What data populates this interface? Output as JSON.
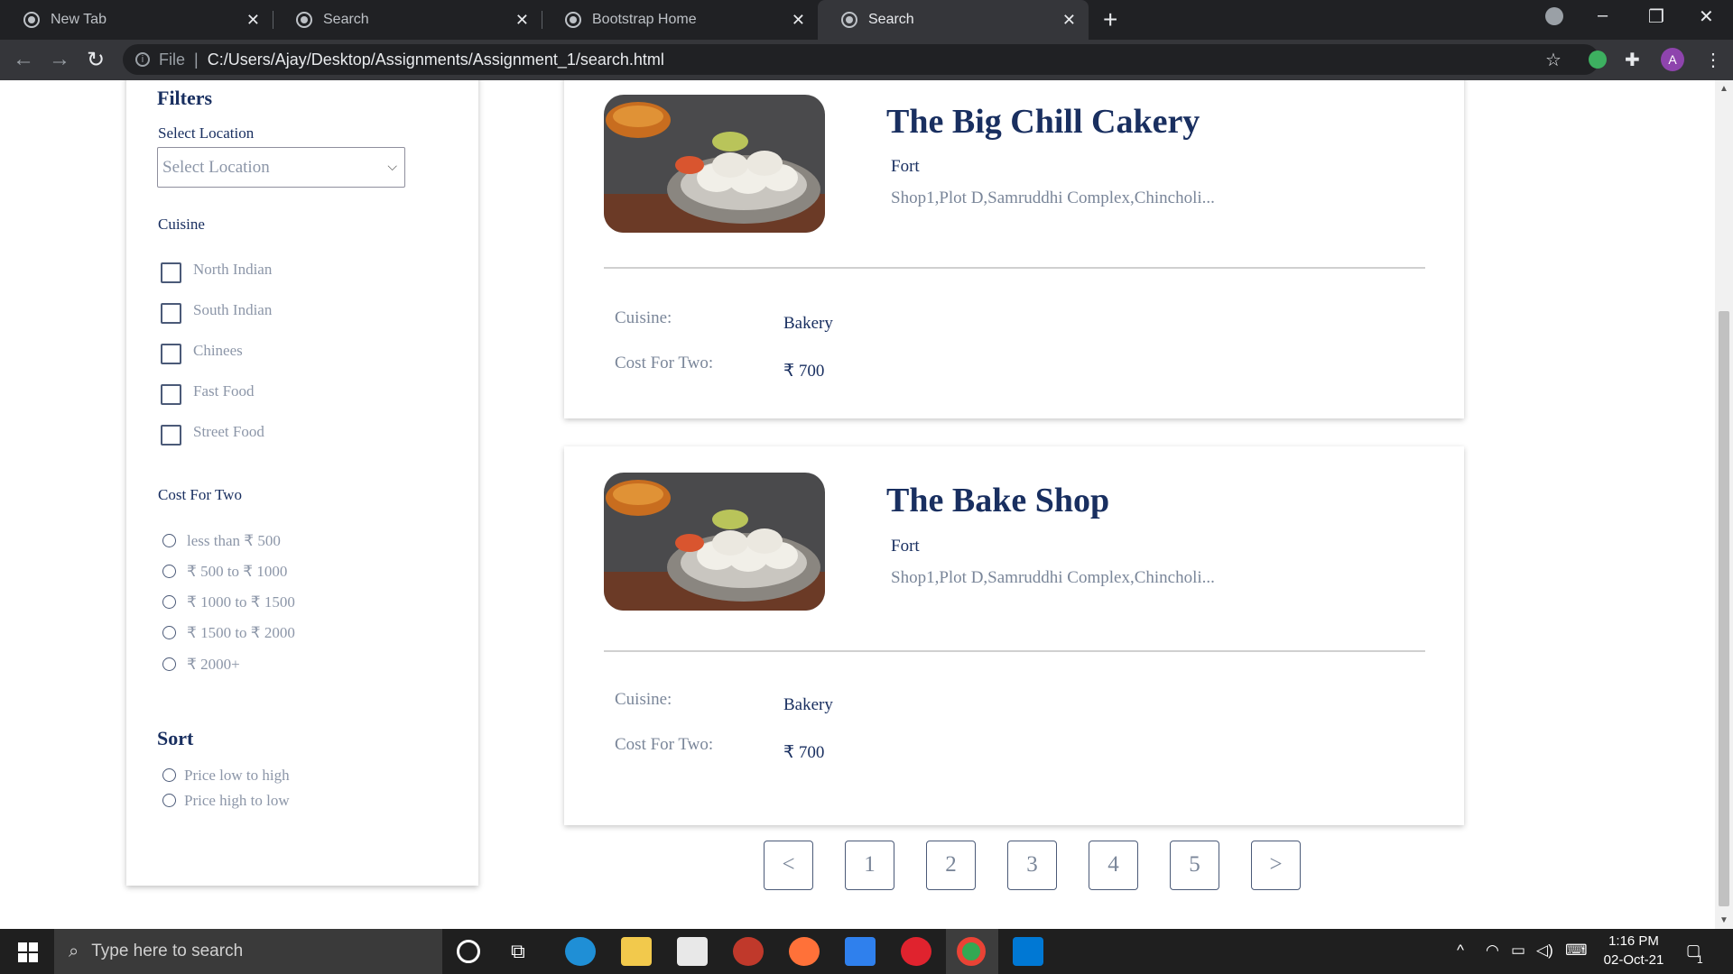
{
  "browser": {
    "tabs": [
      {
        "title": "New Tab"
      },
      {
        "title": "Search"
      },
      {
        "title": "Bootstrap Home"
      },
      {
        "title": "Search"
      }
    ],
    "new_tab": "+",
    "url_scheme": "File",
    "url": "C:/Users/Ajay/Desktop/Assignments/Assignment_1/search.html",
    "profile_initial": "A"
  },
  "filters": {
    "title": "Filters",
    "location_label": "Select Location",
    "location_placeholder": "Select Location",
    "cuisine_label": "Cuisine",
    "cuisines": [
      "North Indian",
      "South Indian",
      "Chinees",
      "Fast Food",
      "Street Food"
    ],
    "cost_label": "Cost For Two",
    "cost_ranges": [
      "less than ₹ 500",
      "₹ 500 to ₹ 1000",
      "₹ 1000 to ₹ 1500",
      "₹ 1500 to ₹ 2000",
      "₹ 2000+"
    ],
    "sort_title": "Sort",
    "sort_options": [
      "Price low to high",
      "Price high to low"
    ]
  },
  "results": [
    {
      "name": "The Big Chill Cakery",
      "area": "Fort",
      "address": "Shop1,Plot D,Samruddhi Complex,Chincholi...",
      "cuisine_key": "Cuisine:",
      "cuisine": "Bakery",
      "cost_key": "Cost For Two:",
      "cost": "₹ 700"
    },
    {
      "name": "The Bake Shop",
      "area": "Fort",
      "address": "Shop1,Plot D,Samruddhi Complex,Chincholi...",
      "cuisine_key": "Cuisine:",
      "cuisine": "Bakery",
      "cost_key": "Cost For Two:",
      "cost": "₹ 700"
    }
  ],
  "pagination": [
    "<",
    "1",
    "2",
    "3",
    "4",
    "5",
    ">"
  ],
  "taskbar": {
    "search_placeholder": "Type here to search",
    "time": "1:16 PM",
    "date": "02-Oct-21",
    "notification_count": "1"
  },
  "colors": {
    "heading": "#192f60",
    "muted": "#7a8699",
    "browser_dark": "#202124"
  }
}
